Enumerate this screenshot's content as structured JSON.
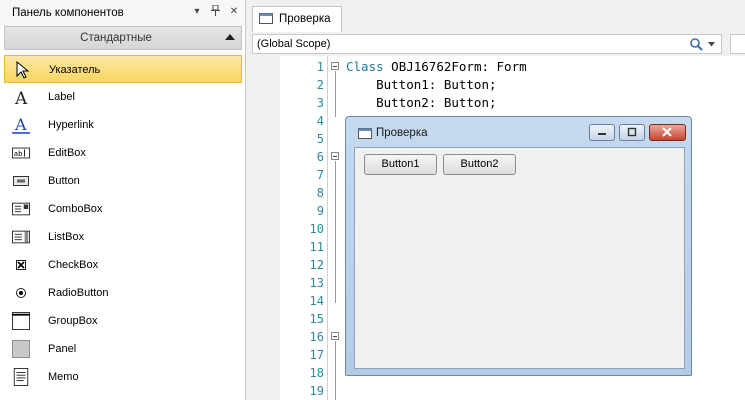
{
  "panel": {
    "title": "Панель компонентов",
    "pin_icon": "pin-icon",
    "close_icon": "close-icon",
    "category": "Стандартные",
    "items": [
      {
        "label": "Указатель",
        "icon": "pointer-icon",
        "selected": true
      },
      {
        "label": "Label",
        "icon": "label-icon"
      },
      {
        "label": "Hyperlink",
        "icon": "hyperlink-icon"
      },
      {
        "label": "EditBox",
        "icon": "editbox-icon"
      },
      {
        "label": "Button",
        "icon": "button-icon"
      },
      {
        "label": "ComboBox",
        "icon": "combobox-icon"
      },
      {
        "label": "ListBox",
        "icon": "listbox-icon"
      },
      {
        "label": "CheckBox",
        "icon": "checkbox-icon"
      },
      {
        "label": "RadioButton",
        "icon": "radiobutton-icon"
      },
      {
        "label": "GroupBox",
        "icon": "groupbox-icon"
      },
      {
        "label": "Panel",
        "icon": "panel-icon"
      },
      {
        "label": "Memo",
        "icon": "memo-icon"
      }
    ]
  },
  "editor": {
    "tab_label": "Проверка",
    "scope": "(Global Scope)",
    "line_numbers": [
      "1",
      "2",
      "3",
      "4",
      "5",
      "6",
      "7",
      "8",
      "9",
      "10",
      "11",
      "12",
      "13",
      "14",
      "15",
      "16",
      "17",
      "18",
      "19"
    ],
    "code": {
      "line1_kw": "Class",
      "line1_rest": " OBJ16762Form: Form",
      "line2": "    Button1: Button;",
      "line3": "    Button2: Button;"
    }
  },
  "form": {
    "title": "Проверка",
    "button1": "Button1",
    "button2": "Button2"
  },
  "colors": {
    "selected_item": "#f9d65e",
    "line_number": "#2a8a9a",
    "keyword": "#1e7aa0",
    "window_frame": "#b4cbe6",
    "close_button": "#c7442f"
  }
}
